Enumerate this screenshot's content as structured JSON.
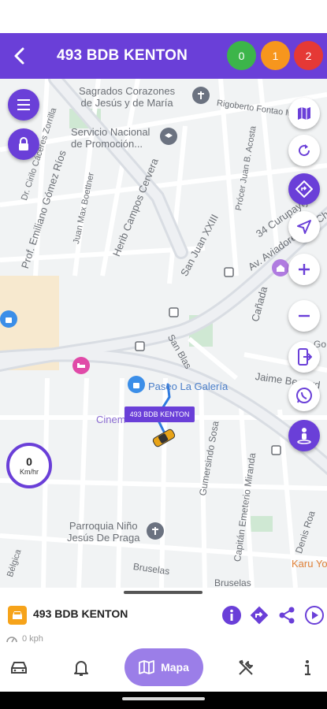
{
  "header": {
    "title": "493 BDB KENTON",
    "badges": [
      {
        "value": "0",
        "color": "#3cb54a"
      },
      {
        "value": "1",
        "color": "#f7961d"
      },
      {
        "value": "2",
        "color": "#e53935"
      }
    ]
  },
  "map": {
    "labels": {
      "sagrados": "Sagrados Corazones\nde Jesús y de María",
      "rigoberto": "Rigoberto Fontao Mer",
      "servicio": "Servicio Nacional\nde Promoción...",
      "cirilo": "Dr. Cirilo Cáceres Zorrilla",
      "emiliano": "Prof. Emiliano Gómez Ríos",
      "boettner": "Juan Max Boettner",
      "herib": "Herib Campos Cervera",
      "proceres": "Prócer Juan B. Acosta",
      "curupayty": "34 Curupayty",
      "aviadores": "Av. Aviadores Del Cha",
      "sanjuan": "San Juan XXIII",
      "canada": "Cañada",
      "sanblas": "San Blas",
      "jaime": "Jaime Bestard",
      "paseo": "Paseo La Galería",
      "cinemark": "Cinem",
      "sosa": "Gumersindo Sosa",
      "capitan": "Capitán Emeterio Miranda",
      "denis": "Denis Roa",
      "parroquia": "Parroquia Niño\nJesús De Praga",
      "karu": "Karu Yo",
      "belgica": "Bélgica",
      "bruselas1": "Bruselas",
      "bruselas2": "Bruselas",
      "go": "Go"
    },
    "vehicle_tag": "493 BDB KENTON",
    "speed": {
      "value": "0",
      "unit": "Km/hr"
    }
  },
  "left_controls": [
    "menu-icon",
    "lock-icon"
  ],
  "right_controls": [
    "map-layers-icon",
    "refresh-icon",
    "directions-icon",
    "navigation-arrow-icon",
    "zoom-in-icon",
    "zoom-out-icon",
    "device-transfer-icon",
    "whatsapp-icon",
    "street-view-icon"
  ],
  "vehicle_panel": {
    "name": "493 BDB KENTON",
    "speed_text": "0 kph"
  },
  "bottom_nav": {
    "active_label": "Mapa",
    "items": [
      "car-icon",
      "bell-icon",
      "map-icon",
      "tools-icon",
      "info-icon"
    ]
  },
  "colors": {
    "primary": "#6a3fd8",
    "active_nav": "#9b7ee8",
    "car_badge": "#f6a31a"
  }
}
